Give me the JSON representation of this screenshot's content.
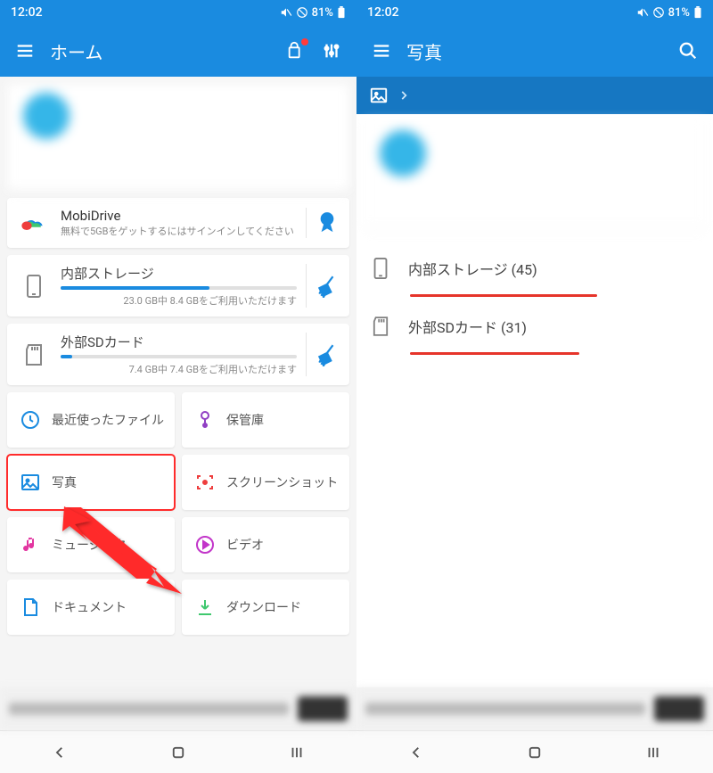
{
  "status": {
    "time": "12:02",
    "battery": "81%"
  },
  "left": {
    "title": "ホーム",
    "mobidrive": {
      "title": "MobiDrive",
      "subtitle": "無料で5GBをゲットするにはサインインしてください"
    },
    "internal": {
      "title": "内部ストレージ",
      "detail": "23.0 GB中 8.4 GBをご利用いただけます",
      "fill_pct": 63
    },
    "external": {
      "title": "外部SDカード",
      "detail": "7.4 GB中 7.4 GBをご利用いただけます",
      "fill_pct": 5
    },
    "cats": {
      "recent": "最近使ったファイル",
      "vault": "保管庫",
      "photos": "写真",
      "screenshot": "スクリーンショット",
      "music": "ミュージック",
      "video": "ビデオ",
      "document": "ドキュメント",
      "download": "ダウンロード"
    }
  },
  "right": {
    "title": "写真",
    "rows": {
      "internal": "内部ストレージ (45)",
      "external": "外部SDカード (31)"
    }
  }
}
